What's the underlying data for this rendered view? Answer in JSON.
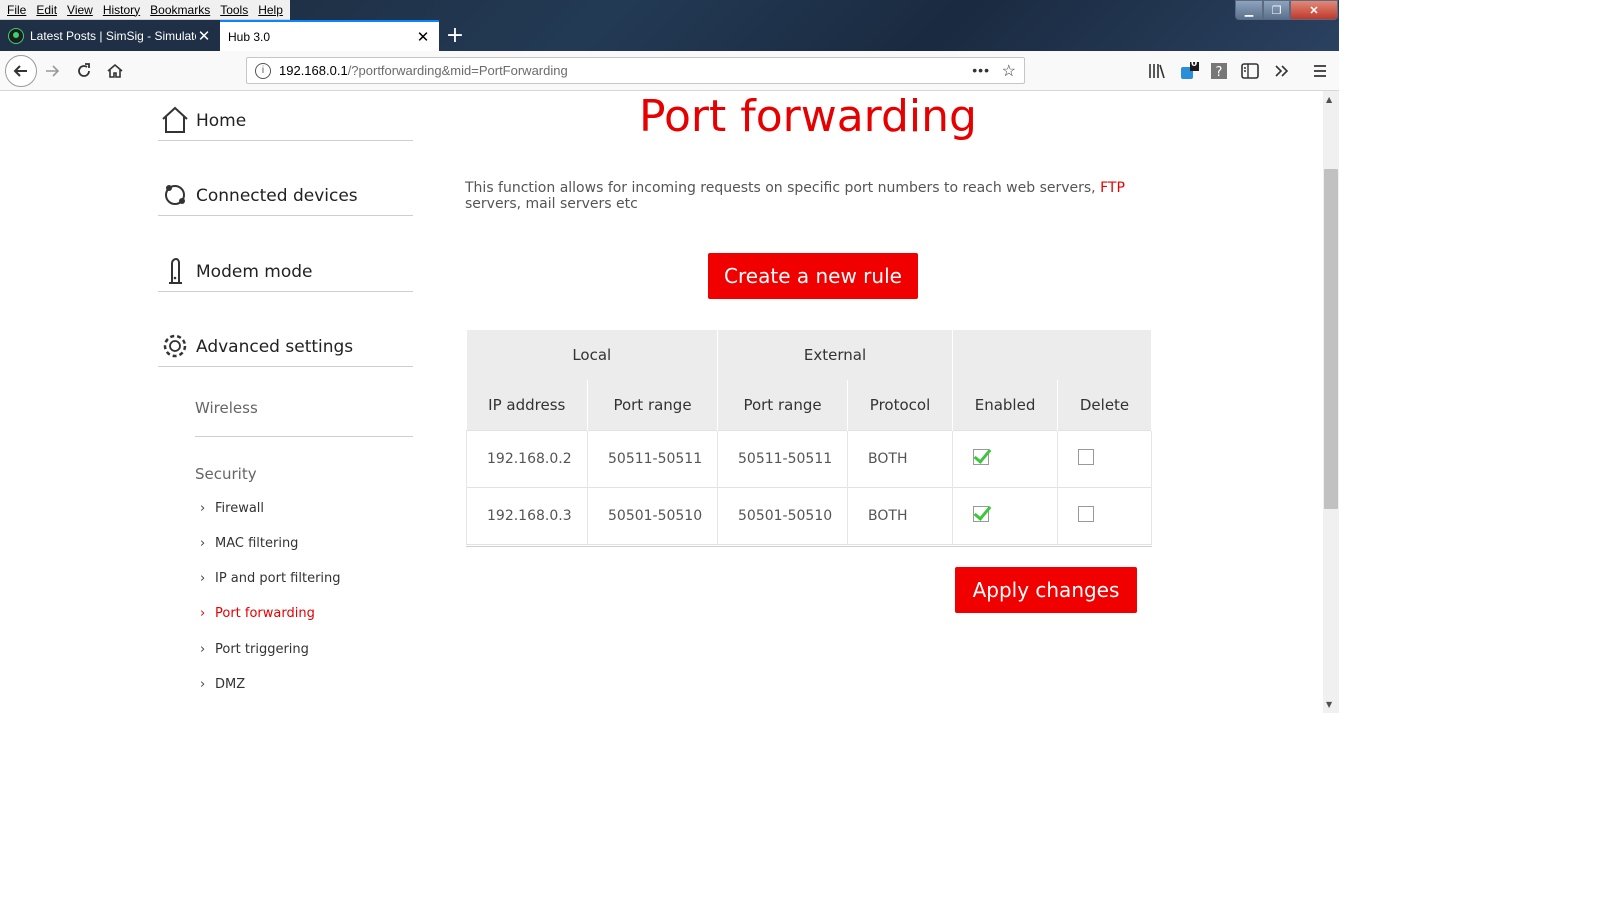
{
  "browser": {
    "menu": [
      "File",
      "Edit",
      "View",
      "History",
      "Bookmarks",
      "Tools",
      "Help"
    ],
    "tabs": [
      {
        "label": "Latest Posts | SimSig - Simulato",
        "active": false
      },
      {
        "label": "Hub 3.0",
        "active": true
      }
    ],
    "url_host": "192.168.0.1",
    "url_path": "/?portforwarding&mid=PortForwarding",
    "extension_badge": "0"
  },
  "sidebar": {
    "main": [
      {
        "label": "Home",
        "icon": "home-icon"
      },
      {
        "label": "Connected devices",
        "icon": "devices-icon"
      },
      {
        "label": "Modem mode",
        "icon": "modem-icon"
      },
      {
        "label": "Advanced settings",
        "icon": "gear-icon"
      }
    ],
    "wireless": "Wireless",
    "security": "Security",
    "security_items": [
      "Firewall",
      "MAC filtering",
      "IP and port filtering",
      "Port forwarding",
      "Port triggering",
      "DMZ"
    ],
    "active_item": "Port forwarding"
  },
  "main": {
    "title": "Port forwarding",
    "description_pre": "This function allows for incoming requests on specific port numbers to reach web servers, ",
    "description_hl": "FTP",
    "description_post": " servers, mail servers etc",
    "create_button": "Create a new rule",
    "apply_button": "Apply changes",
    "table": {
      "group_local": "Local",
      "group_external": "External",
      "headers": [
        "IP address",
        "Port range",
        "Port range",
        "Protocol",
        "Enabled",
        "Delete"
      ],
      "rows": [
        {
          "ip": "192.168.0.2",
          "local_range": "50511-50511",
          "external_range": "50511-50511",
          "protocol": "BOTH",
          "enabled": true,
          "delete": false
        },
        {
          "ip": "192.168.0.3",
          "local_range": "50501-50510",
          "external_range": "50501-50510",
          "protocol": "BOTH",
          "enabled": true,
          "delete": false
        }
      ]
    }
  },
  "colors": {
    "accent": "#e60000",
    "button": "#f10000",
    "check": "#3cc63c"
  }
}
